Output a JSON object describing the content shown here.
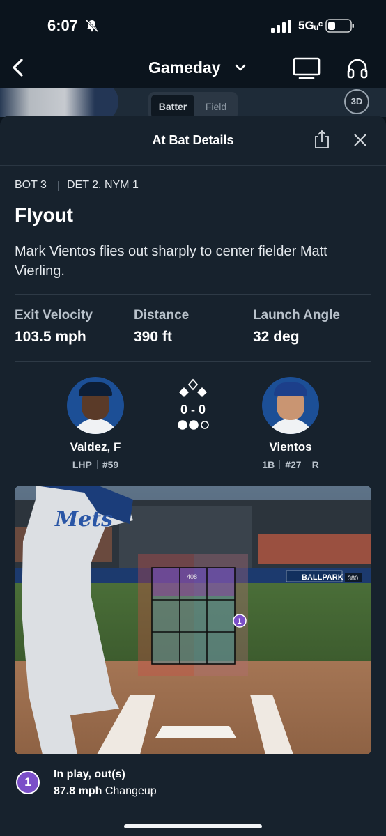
{
  "status": {
    "time": "6:07",
    "network": "5Gᵤᶜ"
  },
  "nav": {
    "title": "Gameday"
  },
  "view_toggle": {
    "batter": "Batter",
    "field": "Field",
    "badge": "3D"
  },
  "sheet": {
    "title": "At Bat Details",
    "inning": "BOT 3",
    "score": "DET 2, NYM 1",
    "result": "Flyout",
    "description": "Mark Vientos flies out sharply to center fielder Matt Vierling.",
    "stats": [
      {
        "label": "Exit Velocity",
        "value": "103.5 mph"
      },
      {
        "label": "Distance",
        "value": "390 ft"
      },
      {
        "label": "Launch Angle",
        "value": "32 deg"
      }
    ],
    "pitcher": {
      "name": "Valdez, F",
      "hand": "LHP",
      "number": "#59"
    },
    "batter": {
      "name": "Vientos",
      "position": "1B",
      "number": "#27",
      "bats": "R"
    },
    "count": "0 - 0",
    "outs_filled": 2,
    "outs_total": 3,
    "scene": {
      "wall_number": "408",
      "ad_text": "BALLPARK",
      "distance_sign": "380",
      "team_script": "Mets"
    },
    "pitch": {
      "number": "1",
      "result": "In play, out(s)",
      "speed": "87.8 mph",
      "type": "Changeup"
    }
  },
  "colors": {
    "background": "#0b141d",
    "sheet": "#17222d",
    "pitch_marker": "#7b4fc8",
    "team_blue": "#1c4f96"
  }
}
